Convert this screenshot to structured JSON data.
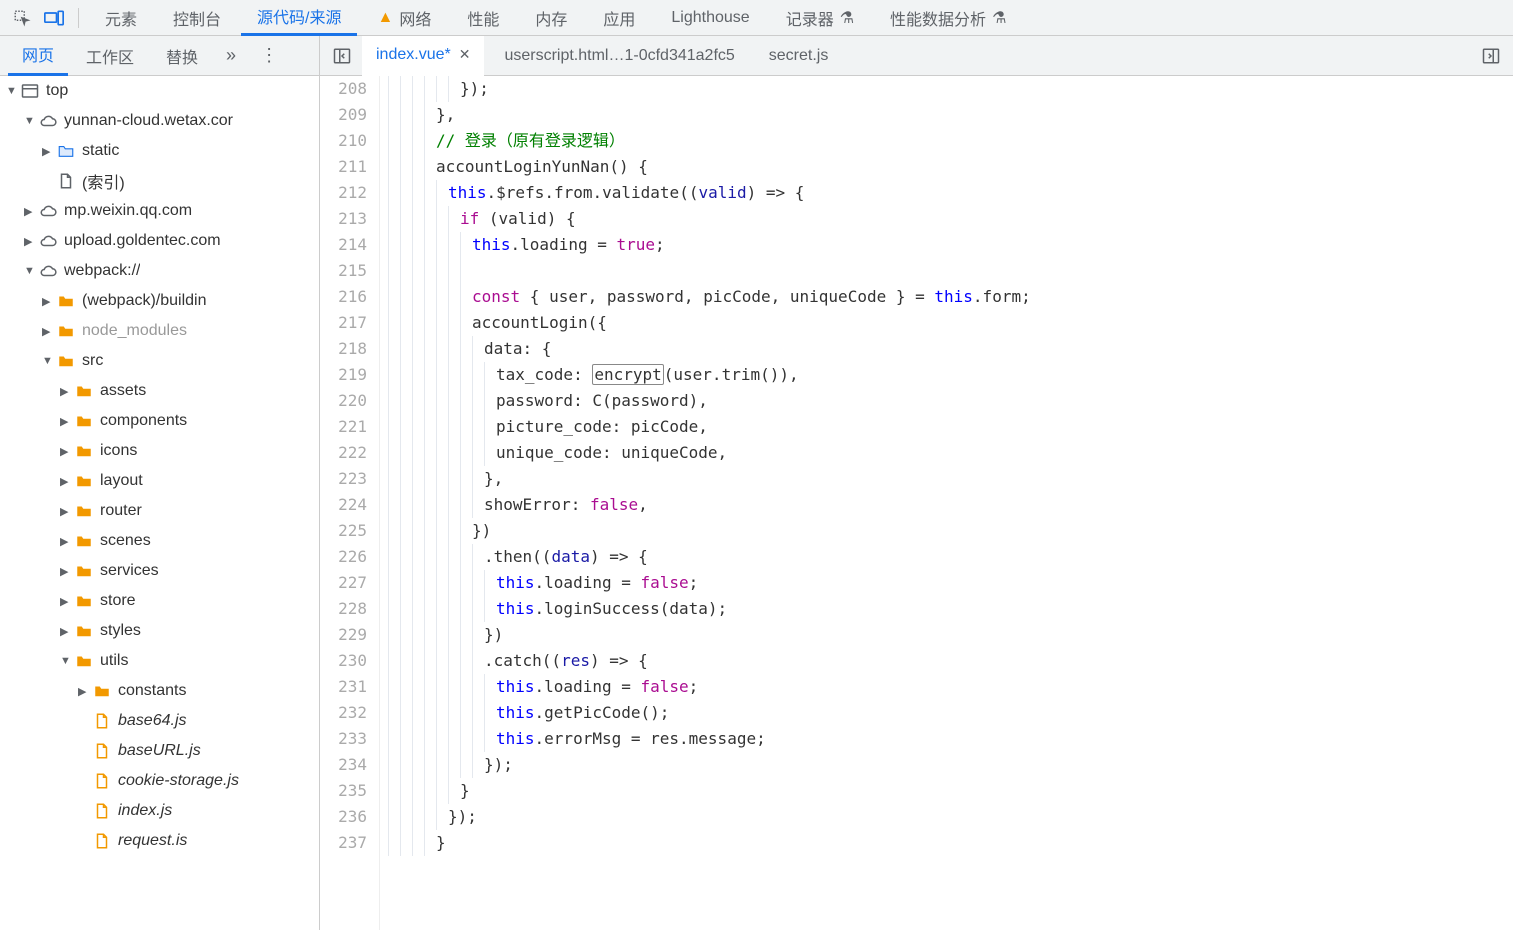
{
  "topTabs": {
    "elements": "元素",
    "console": "控制台",
    "sources": "源代码/来源",
    "network": "网络",
    "performance": "性能",
    "memory": "内存",
    "application": "应用",
    "lighthouse": "Lighthouse",
    "recorder": "记录器",
    "perfInsights": "性能数据分析"
  },
  "secondaryTabs": {
    "page": "网页",
    "workspace": "工作区",
    "replace": "替换",
    "more": "»",
    "dots": "⋮"
  },
  "fileTabs": {
    "active": "index.vue*",
    "t2": "userscript.html…1-0cfd341a2fc5",
    "t3": "secret.js"
  },
  "tree": {
    "top": "top",
    "yunnan": "yunnan-cloud.wetax.cor",
    "static": "static",
    "index": "(索引)",
    "mp": "mp.weixin.qq.com",
    "upload": "upload.goldentec.com",
    "webpack": "webpack://",
    "buildin": "(webpack)/buildin",
    "nodeModules": "node_modules",
    "src": "src",
    "assets": "assets",
    "components": "components",
    "icons": "icons",
    "layout": "layout",
    "router": "router",
    "scenes": "scenes",
    "services": "services",
    "store": "store",
    "styles": "styles",
    "utils": "utils",
    "constants": "constants",
    "base64": "base64.js",
    "baseURL": "baseURL.js",
    "cookieStorage": "cookie-storage.js",
    "indexjs": "index.js",
    "request": "request.is"
  },
  "code": {
    "startLine": 208,
    "lines": [
      {
        "n": 208,
        "i": 6,
        "seg": [
          {
            "t": "});",
            "c": "k-punc"
          }
        ]
      },
      {
        "n": 209,
        "i": 4,
        "seg": [
          {
            "t": "},",
            "c": "k-punc"
          }
        ]
      },
      {
        "n": 210,
        "i": 4,
        "seg": [
          {
            "t": "// 登录（原有登录逻辑）",
            "c": "k-comment"
          }
        ]
      },
      {
        "n": 211,
        "i": 4,
        "seg": [
          {
            "t": "accountLoginYunNan",
            "c": "k-prop"
          },
          {
            "t": "() {",
            "c": "k-punc"
          }
        ]
      },
      {
        "n": 212,
        "i": 5,
        "seg": [
          {
            "t": "this",
            "c": "k-this"
          },
          {
            "t": ".$refs.from.validate((",
            "c": "k-prop"
          },
          {
            "t": "valid",
            "c": "k-var"
          },
          {
            "t": ") => {",
            "c": "k-punc"
          }
        ]
      },
      {
        "n": 213,
        "i": 6,
        "seg": [
          {
            "t": "if",
            "c": "k-kw"
          },
          {
            "t": " (valid) {",
            "c": "k-punc"
          }
        ]
      },
      {
        "n": 214,
        "i": 7,
        "seg": [
          {
            "t": "this",
            "c": "k-this"
          },
          {
            "t": ".loading = ",
            "c": "k-prop"
          },
          {
            "t": "true",
            "c": "k-bool"
          },
          {
            "t": ";",
            "c": "k-punc"
          }
        ]
      },
      {
        "n": 215,
        "i": 7,
        "seg": []
      },
      {
        "n": 216,
        "i": 7,
        "seg": [
          {
            "t": "const",
            "c": "k-kw"
          },
          {
            "t": " { user, password, picCode, uniqueCode } = ",
            "c": "k-prop"
          },
          {
            "t": "this",
            "c": "k-this"
          },
          {
            "t": ".form;",
            "c": "k-prop"
          }
        ]
      },
      {
        "n": 217,
        "i": 7,
        "seg": [
          {
            "t": "accountLogin({",
            "c": "k-prop"
          }
        ]
      },
      {
        "n": 218,
        "i": 8,
        "seg": [
          {
            "t": "data: {",
            "c": "k-prop"
          }
        ]
      },
      {
        "n": 219,
        "i": 9,
        "seg": [
          {
            "t": "tax_code: ",
            "c": "k-prop"
          },
          {
            "t": "encrypt",
            "c": "k-boxed"
          },
          {
            "t": "(user.trim()),",
            "c": "k-prop"
          }
        ]
      },
      {
        "n": 220,
        "i": 9,
        "seg": [
          {
            "t": "password: C(password),",
            "c": "k-prop"
          }
        ]
      },
      {
        "n": 221,
        "i": 9,
        "seg": [
          {
            "t": "picture_code: picCode,",
            "c": "k-prop"
          }
        ]
      },
      {
        "n": 222,
        "i": 9,
        "seg": [
          {
            "t": "unique_code: uniqueCode,",
            "c": "k-prop"
          }
        ]
      },
      {
        "n": 223,
        "i": 8,
        "seg": [
          {
            "t": "},",
            "c": "k-punc"
          }
        ]
      },
      {
        "n": 224,
        "i": 8,
        "seg": [
          {
            "t": "showError: ",
            "c": "k-prop"
          },
          {
            "t": "false",
            "c": "k-bool"
          },
          {
            "t": ",",
            "c": "k-punc"
          }
        ]
      },
      {
        "n": 225,
        "i": 7,
        "seg": [
          {
            "t": "})",
            "c": "k-punc"
          }
        ]
      },
      {
        "n": 226,
        "i": 8,
        "seg": [
          {
            "t": ".then((",
            "c": "k-prop"
          },
          {
            "t": "data",
            "c": "k-var"
          },
          {
            "t": ") => {",
            "c": "k-punc"
          }
        ]
      },
      {
        "n": 227,
        "i": 9,
        "seg": [
          {
            "t": "this",
            "c": "k-this"
          },
          {
            "t": ".loading = ",
            "c": "k-prop"
          },
          {
            "t": "false",
            "c": "k-bool"
          },
          {
            "t": ";",
            "c": "k-punc"
          }
        ]
      },
      {
        "n": 228,
        "i": 9,
        "seg": [
          {
            "t": "this",
            "c": "k-this"
          },
          {
            "t": ".loginSuccess(data);",
            "c": "k-prop"
          }
        ]
      },
      {
        "n": 229,
        "i": 8,
        "seg": [
          {
            "t": "})",
            "c": "k-punc"
          }
        ]
      },
      {
        "n": 230,
        "i": 8,
        "seg": [
          {
            "t": ".catch((",
            "c": "k-prop"
          },
          {
            "t": "res",
            "c": "k-var"
          },
          {
            "t": ") => {",
            "c": "k-punc"
          }
        ]
      },
      {
        "n": 231,
        "i": 9,
        "seg": [
          {
            "t": "this",
            "c": "k-this"
          },
          {
            "t": ".loading = ",
            "c": "k-prop"
          },
          {
            "t": "false",
            "c": "k-bool"
          },
          {
            "t": ";",
            "c": "k-punc"
          }
        ]
      },
      {
        "n": 232,
        "i": 9,
        "seg": [
          {
            "t": "this",
            "c": "k-this"
          },
          {
            "t": ".getPicCode();",
            "c": "k-prop"
          }
        ]
      },
      {
        "n": 233,
        "i": 9,
        "seg": [
          {
            "t": "this",
            "c": "k-this"
          },
          {
            "t": ".errorMsg = res.message;",
            "c": "k-prop"
          }
        ]
      },
      {
        "n": 234,
        "i": 8,
        "seg": [
          {
            "t": "});",
            "c": "k-punc"
          }
        ]
      },
      {
        "n": 235,
        "i": 6,
        "seg": [
          {
            "t": "}",
            "c": "k-punc"
          }
        ]
      },
      {
        "n": 236,
        "i": 5,
        "seg": [
          {
            "t": "});",
            "c": "k-punc"
          }
        ]
      },
      {
        "n": 237,
        "i": 4,
        "seg": [
          {
            "t": "}",
            "c": "k-punc"
          }
        ]
      }
    ]
  }
}
